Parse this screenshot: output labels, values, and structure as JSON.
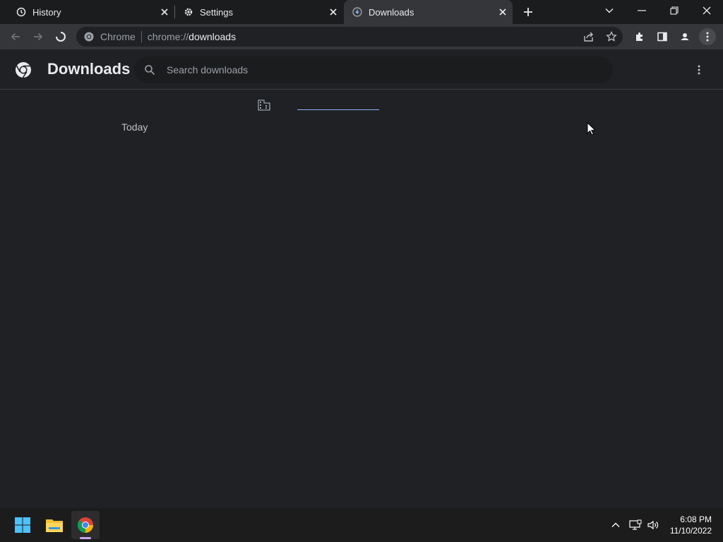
{
  "tabs": [
    {
      "title": "History",
      "icon": "history-icon"
    },
    {
      "title": "Settings",
      "icon": "gear-icon"
    },
    {
      "title": "Downloads",
      "icon": "download-icon",
      "active": true
    }
  ],
  "omnibox": {
    "scheme_label": "Chrome",
    "url_prefix": "chrome://",
    "url_path": "downloads"
  },
  "page": {
    "title": "Downloads",
    "search_placeholder": "Search downloads"
  },
  "content": {
    "section_label": "Today"
  },
  "taskbar": {
    "time": "6:08 PM",
    "date": "11/10/2022"
  },
  "colors": {
    "accent": "#8ab4f8",
    "page_bg": "#202124",
    "toolbar_bg": "#35363a"
  }
}
